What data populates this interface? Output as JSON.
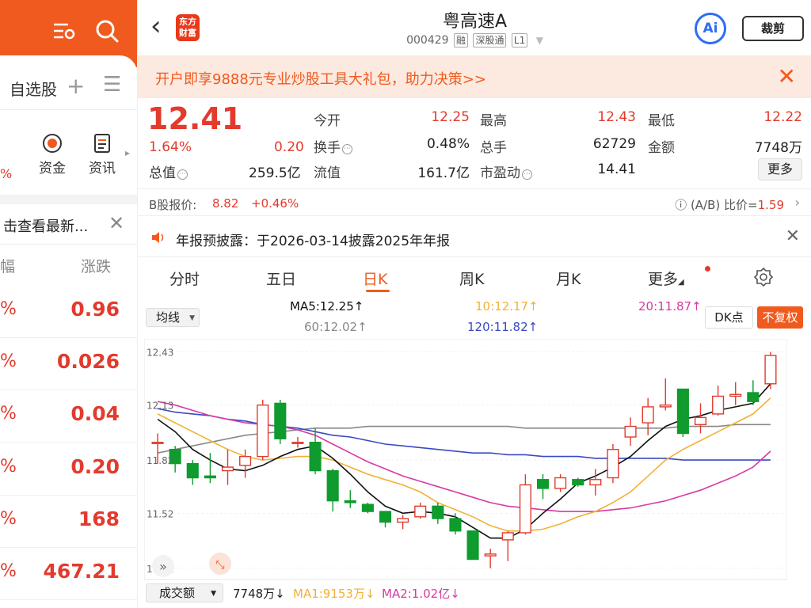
{
  "left": {
    "tab_self": "自选股",
    "quick": [
      "资金",
      "资讯"
    ],
    "notice": "击查看最新...",
    "columns": [
      "幅",
      "涨跌"
    ],
    "rows": [
      {
        "pct": "%",
        "value": "0.96"
      },
      {
        "pct": "%",
        "value": "0.026"
      },
      {
        "pct": "%",
        "value": "0.04"
      },
      {
        "pct": "%",
        "value": "0.20"
      },
      {
        "pct": "%",
        "value": "168"
      },
      {
        "pct": "%",
        "value": "467.21"
      }
    ],
    "edge": "%"
  },
  "header": {
    "name": "粤高速A",
    "code": "000429",
    "tags": [
      "融",
      "深股通",
      "L1"
    ],
    "brand": "东方\n财富",
    "ai": "Ai",
    "crop": "裁剪"
  },
  "banner": {
    "text": "开户即享9888元专业炒股工具大礼包，助力决策>>"
  },
  "quote": {
    "price": "12.41",
    "pct": "1.64%",
    "change": "0.20",
    "total_value_label": "总值",
    "total_value": "259.5亿",
    "cells": [
      {
        "label": "今开",
        "value": "12.25",
        "color": "red"
      },
      {
        "label": "最高",
        "value": "12.43",
        "color": "red"
      },
      {
        "label": "最低",
        "value": "12.22",
        "color": "red"
      },
      {
        "label": "换手",
        "value": "0.48%",
        "color": "dark"
      },
      {
        "label": "总手",
        "value": "62729",
        "color": "dark"
      },
      {
        "label": "金额",
        "value": "7748万",
        "color": "dark"
      },
      {
        "label": "流值",
        "value": "161.7亿",
        "color": "dark"
      },
      {
        "label": "市盈动",
        "value": "14.41",
        "color": "dark"
      }
    ],
    "more": "更多"
  },
  "bshare": {
    "label": "B股报价:",
    "price": "8.82",
    "pct": "+0.46%",
    "ratio_label": "(A/B) 比价=",
    "ratio": "1.59"
  },
  "announcement": {
    "text": "年报预披露：于2026-03-14披露2025年年报"
  },
  "tabs": [
    "分时",
    "五日",
    "日K",
    "周K",
    "月K",
    "更多"
  ],
  "chart_header": {
    "select": "均线",
    "ma5": "MA5:12.25↑",
    "ma10": "10:12.17↑",
    "ma20": "20:11.87↑",
    "ma60": "60:12.02↑",
    "ma120": "120:11.82↑",
    "dk": "DK点",
    "fq": "不复权"
  },
  "volume_header": {
    "select": "成交额",
    "vol": "7748万↓",
    "ma1": "MA1:9153万↓",
    "ma2": "MA2:1.02亿↓"
  },
  "colors": {
    "up": "#e23b2e",
    "down": "#0f9b2d",
    "accent": "#f05a1e",
    "ma5": "#111111",
    "ma10": "#f2b134",
    "ma20": "#d63aa5",
    "ma60": "#888888",
    "ma120": "#3a4ac2"
  },
  "chart_data": {
    "type": "candlestick",
    "ylim": [
      11.2,
      12.45
    ],
    "y_ticks": [
      "12.43",
      "12.13",
      "11.82",
      "11.52",
      "11.21"
    ],
    "candles": [
      {
        "o": 11.92,
        "c": 11.92,
        "h": 11.97,
        "l": 11.8
      },
      {
        "o": 11.88,
        "c": 11.8,
        "h": 11.9,
        "l": 11.75
      },
      {
        "o": 11.8,
        "c": 11.72,
        "h": 11.82,
        "l": 11.68
      },
      {
        "o": 11.73,
        "c": 11.72,
        "h": 11.86,
        "l": 11.69
      },
      {
        "o": 11.76,
        "c": 11.78,
        "h": 11.88,
        "l": 11.68
      },
      {
        "o": 11.79,
        "c": 11.84,
        "h": 11.88,
        "l": 11.72
      },
      {
        "o": 11.84,
        "c": 12.13,
        "h": 12.16,
        "l": 11.82
      },
      {
        "o": 12.14,
        "c": 11.94,
        "h": 12.16,
        "l": 11.91
      },
      {
        "o": 11.92,
        "c": 11.92,
        "h": 11.95,
        "l": 11.89
      },
      {
        "o": 11.92,
        "c": 11.76,
        "h": 12.0,
        "l": 11.74
      },
      {
        "o": 11.76,
        "c": 11.59,
        "h": 11.77,
        "l": 11.53
      },
      {
        "o": 11.59,
        "c": 11.58,
        "h": 11.65,
        "l": 11.55
      },
      {
        "o": 11.57,
        "c": 11.53,
        "h": 11.58,
        "l": 11.52
      },
      {
        "o": 11.53,
        "c": 11.47,
        "h": 11.53,
        "l": 11.44
      },
      {
        "o": 11.47,
        "c": 11.49,
        "h": 11.51,
        "l": 11.43
      },
      {
        "o": 11.5,
        "c": 11.56,
        "h": 11.58,
        "l": 11.49
      },
      {
        "o": 11.56,
        "c": 11.49,
        "h": 11.58,
        "l": 11.46
      },
      {
        "o": 11.49,
        "c": 11.42,
        "h": 11.52,
        "l": 11.4
      },
      {
        "o": 11.42,
        "c": 11.26,
        "h": 11.42,
        "l": 11.26
      },
      {
        "o": 11.28,
        "c": 11.29,
        "h": 11.32,
        "l": 11.21
      },
      {
        "o": 11.37,
        "c": 11.41,
        "h": 11.42,
        "l": 11.25
      },
      {
        "o": 11.41,
        "c": 11.68,
        "h": 11.74,
        "l": 11.4
      },
      {
        "o": 11.71,
        "c": 11.66,
        "h": 11.74,
        "l": 11.6
      },
      {
        "o": 11.66,
        "c": 11.72,
        "h": 11.74,
        "l": 11.64
      },
      {
        "o": 11.71,
        "c": 11.68,
        "h": 11.72,
        "l": 11.67
      },
      {
        "o": 11.68,
        "c": 11.71,
        "h": 11.77,
        "l": 11.62
      },
      {
        "o": 11.72,
        "c": 11.88,
        "h": 11.91,
        "l": 11.69
      },
      {
        "o": 11.95,
        "c": 12.01,
        "h": 12.06,
        "l": 11.9
      },
      {
        "o": 12.03,
        "c": 12.12,
        "h": 12.17,
        "l": 11.96
      },
      {
        "o": 12.12,
        "c": 12.13,
        "h": 12.28,
        "l": 12.1
      },
      {
        "o": 12.22,
        "c": 11.97,
        "h": 12.22,
        "l": 11.95
      },
      {
        "o": 12.02,
        "c": 12.06,
        "h": 12.14,
        "l": 11.97
      },
      {
        "o": 12.08,
        "c": 12.18,
        "h": 12.24,
        "l": 12.07
      },
      {
        "o": 12.18,
        "c": 12.19,
        "h": 12.26,
        "l": 12.13
      },
      {
        "o": 12.2,
        "c": 12.15,
        "h": 12.27,
        "l": 12.13
      },
      {
        "o": 12.25,
        "c": 12.41,
        "h": 12.43,
        "l": 12.22
      }
    ],
    "ma5": [
      12.05,
      11.98,
      11.88,
      11.82,
      11.77,
      11.76,
      11.79,
      11.84,
      11.88,
      11.9,
      11.83,
      11.74,
      11.64,
      11.56,
      11.52,
      11.53,
      11.52,
      11.5,
      11.44,
      11.38,
      11.38,
      11.43,
      11.52,
      11.6,
      11.69,
      11.73,
      11.78,
      11.84,
      11.93,
      12.01,
      12.05,
      12.07,
      12.1,
      12.12,
      12.14,
      12.25
    ],
    "ma10": [
      12.08,
      12.03,
      11.98,
      11.93,
      11.88,
      11.84,
      11.82,
      11.83,
      11.84,
      11.84,
      11.82,
      11.78,
      11.74,
      11.71,
      11.68,
      11.64,
      11.58,
      11.54,
      11.5,
      11.45,
      11.42,
      11.42,
      11.43,
      11.46,
      11.5,
      11.53,
      11.58,
      11.64,
      11.73,
      11.82,
      11.88,
      11.93,
      11.98,
      12.03,
      12.08,
      12.17
    ],
    "ma20": [
      12.15,
      12.13,
      12.1,
      12.07,
      12.05,
      12.03,
      12.02,
      12.01,
      11.99,
      11.96,
      11.91,
      11.86,
      11.81,
      11.77,
      11.73,
      11.7,
      11.67,
      11.64,
      11.61,
      11.58,
      11.56,
      11.55,
      11.54,
      11.53,
      11.53,
      11.53,
      11.54,
      11.55,
      11.57,
      11.59,
      11.62,
      11.65,
      11.69,
      11.73,
      11.78,
      11.87
    ],
    "ma60": [
      11.86,
      11.88,
      11.9,
      11.92,
      11.94,
      11.96,
      11.97,
      11.98,
      11.99,
      12.0,
      12.0,
      12.0,
      12.01,
      12.01,
      12.01,
      12.01,
      12.01,
      12.01,
      12.01,
      12.01,
      12.01,
      12.0,
      12.0,
      12.0,
      12.0,
      12.0,
      12.0,
      12.0,
      12.0,
      12.0,
      12.01,
      12.01,
      12.01,
      12.02,
      12.02,
      12.02
    ],
    "ma120": [
      12.11,
      12.09,
      12.08,
      12.07,
      12.05,
      12.04,
      12.02,
      12.01,
      12.0,
      11.98,
      11.96,
      11.95,
      11.93,
      11.91,
      11.9,
      11.89,
      11.88,
      11.87,
      11.86,
      11.86,
      11.85,
      11.85,
      11.84,
      11.84,
      11.84,
      11.83,
      11.83,
      11.83,
      11.83,
      11.83,
      11.82,
      11.82,
      11.82,
      11.82,
      11.82,
      11.82
    ]
  }
}
